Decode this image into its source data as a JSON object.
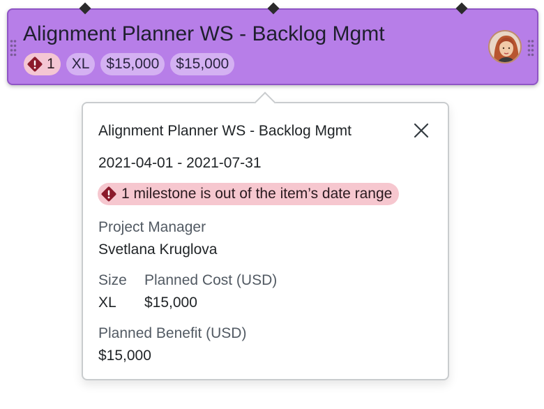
{
  "card": {
    "title": "Alignment Planner WS - Backlog Mgmt",
    "warning_count": "1",
    "size": "XL",
    "planned_cost": "$15,000",
    "planned_benefit": "$15,000",
    "icons": [
      "warning-diamond-icon",
      "drag-handle-icon",
      "avatar"
    ],
    "colors": {
      "background": "#b77ee8",
      "border": "#8f55c5",
      "chip": "#d4b1f2",
      "warning_chip": "#f4c6d3"
    }
  },
  "popover": {
    "title": "Alignment Planner WS - Backlog Mgmt",
    "close_icon": "close-icon",
    "date_range": "2021-04-01 - 2021-07-31",
    "alert_text": "1 milestone is out of the item’s date range",
    "alert_color": "#f6c7cf",
    "project_manager_label": "Project Manager",
    "project_manager_value": "Svetlana Kruglova",
    "size_label": "Size",
    "size_value": "XL",
    "planned_cost_label": "Planned Cost (USD)",
    "planned_cost_value": "$15,000",
    "planned_benefit_label": "Planned Benefit (USD)",
    "planned_benefit_value": "$15,000"
  }
}
